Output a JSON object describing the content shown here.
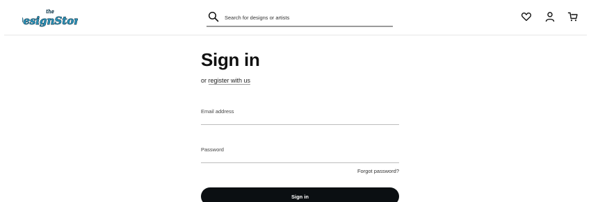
{
  "header": {
    "logo": {
      "text": "the Design Store",
      "icon": "design-store-logo"
    },
    "search": {
      "placeholder": "Search for designs or artists",
      "value": "",
      "icon": "search-icon"
    },
    "nav_icons": [
      "heart-icon",
      "user-icon",
      "cart-icon"
    ]
  },
  "form": {
    "title": "Sign in",
    "register_prefix": "or ",
    "register_link": "register with us",
    "email_label": "Email address",
    "email_value": "",
    "password_label": "Password",
    "password_value": "",
    "forgot_link": "Forgot password?",
    "submit_label": "Sign in"
  },
  "colors": {
    "primary_button": "#0b0f12",
    "logo_fill": "#2a8fb5",
    "logo_stroke": "#0d2a3a"
  }
}
